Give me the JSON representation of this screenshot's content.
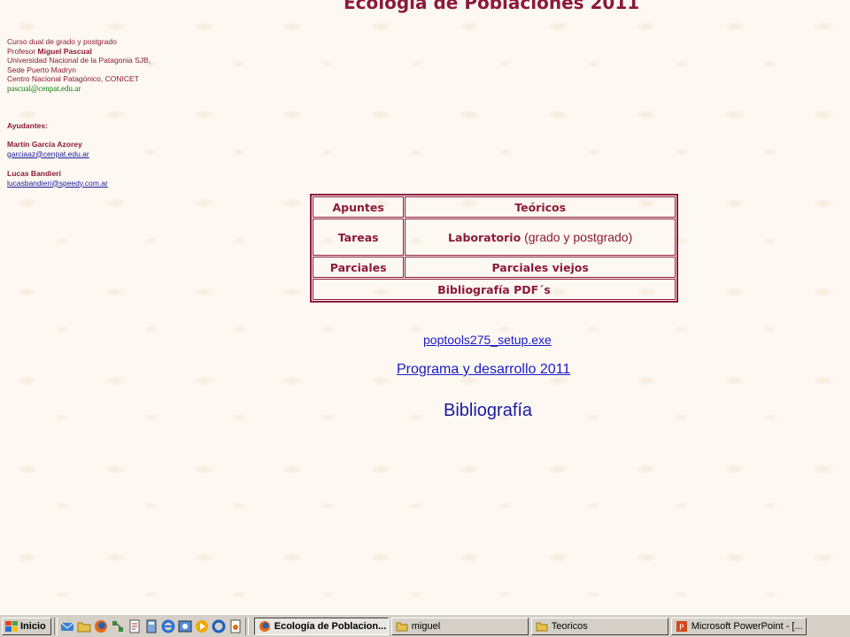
{
  "title": "Ecología de Poblaciones 2011",
  "info": {
    "course": "Curso dual de grado y postgrado",
    "professor_prefix": "Profesor ",
    "professor_name": "Miguel Pascual",
    "university": "Universidad Nacional de la Patagonia SJB,",
    "seat": "Sede Puerto Madryn",
    "center": "Centro Nacional Patagónico, CONICET",
    "professor_email": "pascual@cenpat.edu.ar",
    "assistants_heading": "Ayudantes:",
    "assistant1_name": "Martín García Azorey",
    "assistant1_email": "garciaaz@cenpat.edu.ar",
    "assistant2_name": "Lucas Bandieri",
    "assistant2_email": "lucasbandieri@speedy.com.ar"
  },
  "menu": {
    "apuntes": "Apuntes",
    "teoricos": "Teóricos",
    "tareas": "Tareas",
    "laboratorio": "Laboratorio",
    "laboratorio_note": " (grado y postgrado)",
    "parciales": "Parciales",
    "parciales_viejos": "Parciales viejos",
    "bibliografia_pdf": "Bibliografía PDF´s"
  },
  "links": {
    "poptools": "poptools275_setup.exe",
    "programa": "Programa y desarrollo 2011",
    "bibliografia": "Bibliografía"
  },
  "taskbar": {
    "start_label": "Inicio",
    "quicklaunch_icons": [
      "outlook-express-icon",
      "folder-icon",
      "firefox-icon",
      "network-icon",
      "document-icon",
      "calculator-icon",
      "ie-icon",
      "ie-alt-icon",
      "media-player-icon",
      "ie-small-icon",
      "notepad-icon"
    ],
    "tasks": [
      {
        "label": "Ecología de Poblacion...",
        "icon": "firefox-icon",
        "active": true
      },
      {
        "label": "miguel",
        "icon": "folder-icon",
        "active": false
      },
      {
        "label": "Teoricos",
        "icon": "folder-icon",
        "active": false
      },
      {
        "label": "Microsoft PowerPoint - [...",
        "icon": "powerpoint-icon",
        "active": false
      }
    ]
  },
  "colors": {
    "accent": "#8b1a3c",
    "link": "#1a1ac8",
    "email_green": "#0a7a0a",
    "background": "#fdf8f1",
    "taskbar": "#d4d0c8"
  }
}
